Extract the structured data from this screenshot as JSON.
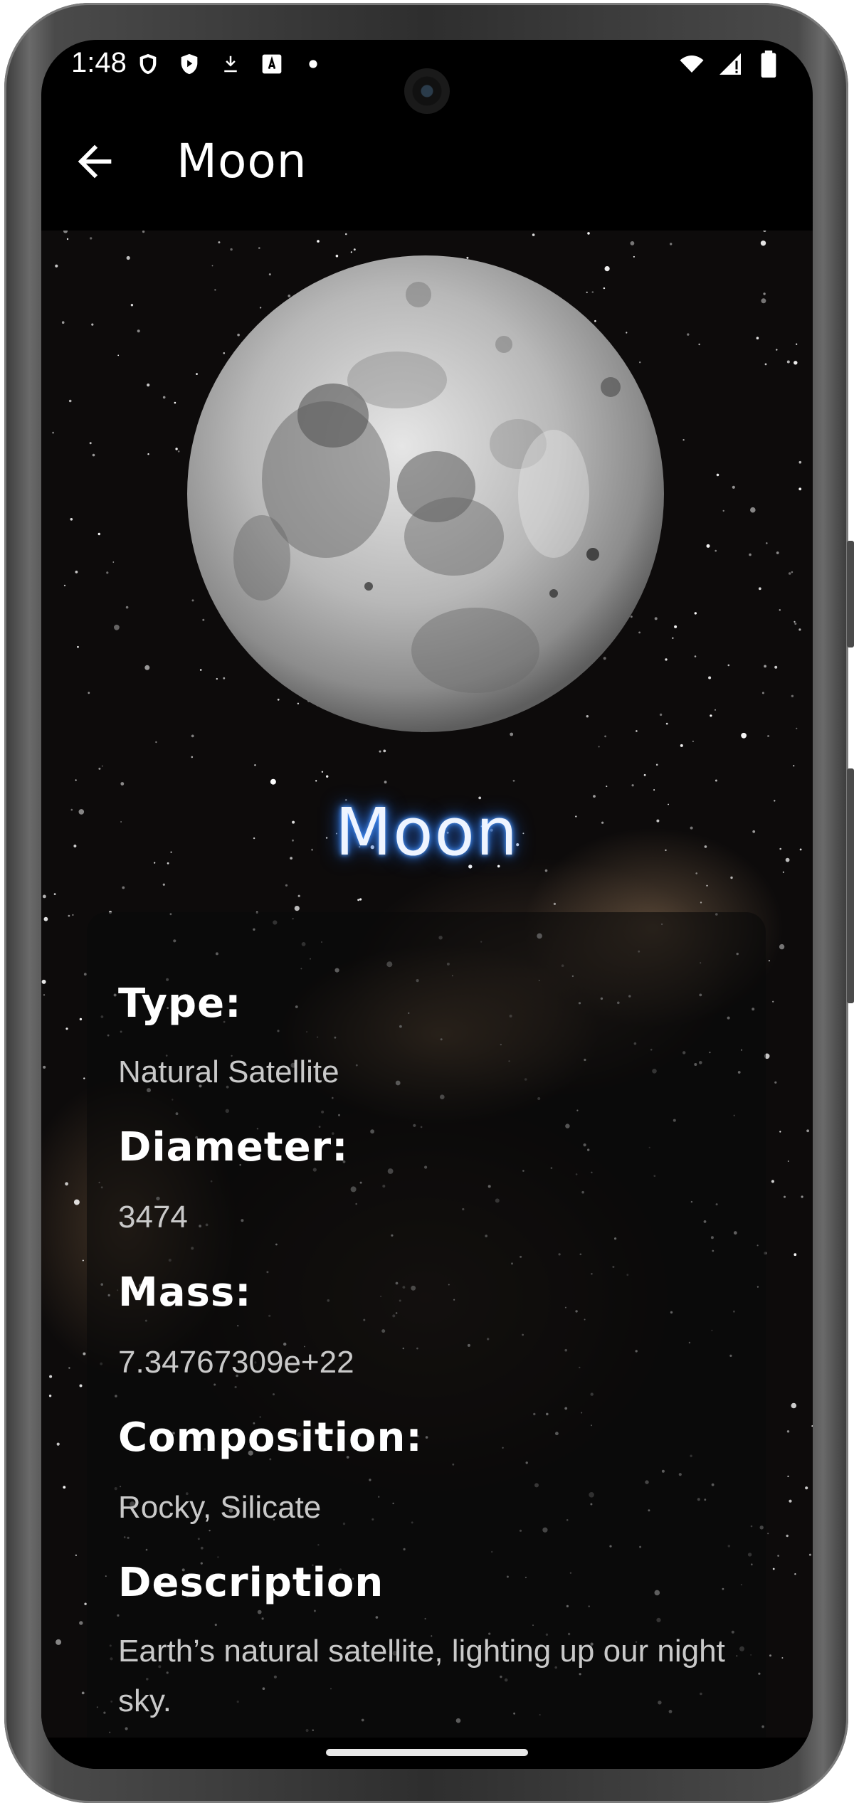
{
  "status_bar": {
    "time": "1:48",
    "left_icons": [
      "shield-icon",
      "play-protect-icon",
      "download-icon",
      "font-a-icon",
      "dot-icon"
    ],
    "right_icons": [
      "wifi-icon",
      "signal-icon",
      "battery-icon"
    ]
  },
  "app_bar": {
    "back_icon": "arrow-left-icon",
    "title": "Moon"
  },
  "hero": {
    "image": "moon-image",
    "title": "Moon",
    "glow_color": "#3b8cff"
  },
  "details": [
    {
      "label": "Type:",
      "value": "Natural Satellite"
    },
    {
      "label": "Diameter:",
      "value": "3474"
    },
    {
      "label": "Mass:",
      "value": "7.34767309e+22"
    },
    {
      "label": "Composition:",
      "value": "Rocky, Silicate"
    },
    {
      "label": "Description",
      "value": "Earth’s natural satellite, lighting up our night sky."
    }
  ]
}
